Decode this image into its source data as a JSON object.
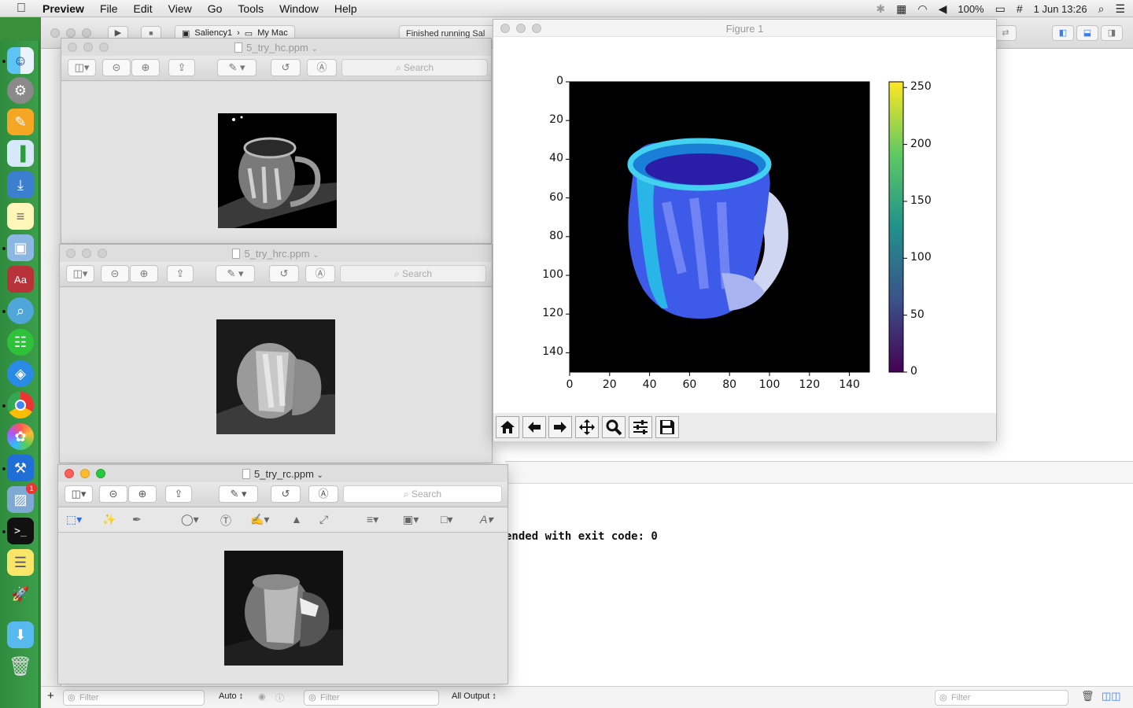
{
  "menubar": {
    "app_name": "Preview",
    "items": [
      "File",
      "Edit",
      "View",
      "Go",
      "Tools",
      "Window",
      "Help"
    ],
    "battery": "100%",
    "clock": "1 Jun  13:26"
  },
  "ide": {
    "scheme_name": "Saliency1",
    "destination": "My Mac",
    "status": "Finished running Sal",
    "console_text": "ended with exit code: 0",
    "bottom_filter_1": "Filter",
    "bottom_filter_2": "Filter",
    "bottom_filter_3": "Filter",
    "auto_label": "Auto ↕",
    "all_output_label": "All Output ↕"
  },
  "windows": {
    "hc": {
      "title": "5_try_hc.ppm",
      "search_placeholder": "Search"
    },
    "hrc": {
      "title": "5_try_hrc.ppm",
      "search_placeholder": "Search"
    },
    "rc": {
      "title": "5_try_rc.ppm",
      "search_placeholder": "Search"
    }
  },
  "figure": {
    "title": "Figure 1",
    "x_ticks": [
      "0",
      "20",
      "40",
      "60",
      "80",
      "100",
      "120",
      "140"
    ],
    "y_ticks": [
      "0",
      "20",
      "40",
      "60",
      "80",
      "100",
      "120",
      "140"
    ],
    "colorbar_ticks": [
      "250",
      "200",
      "150",
      "100",
      "50",
      "0"
    ],
    "colormap": "viridis"
  },
  "chart_data": {
    "type": "heatmap",
    "xlim": [
      0,
      150
    ],
    "ylim": [
      150,
      0
    ],
    "colorbar_range": [
      0,
      255
    ],
    "x_ticks": [
      0,
      20,
      40,
      60,
      80,
      100,
      120,
      140
    ],
    "y_ticks": [
      0,
      20,
      40,
      60,
      80,
      100,
      120,
      140
    ],
    "colorbar_ticks": [
      0,
      50,
      100,
      150,
      200,
      250
    ]
  },
  "dock_badge": "1"
}
